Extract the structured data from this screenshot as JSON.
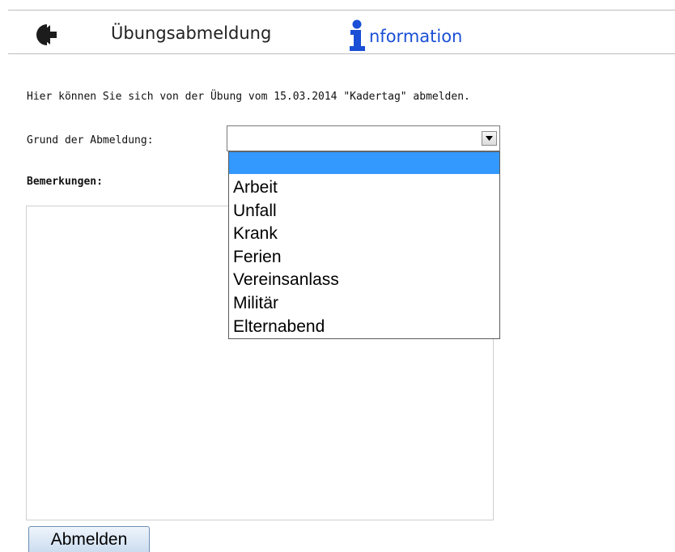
{
  "header": {
    "back_icon": "back-arrow-icon",
    "title": "Übungsabmeldung",
    "info_icon": "info-i-icon",
    "info_link": "nformation",
    "accent_color": "#1a4fd6"
  },
  "form": {
    "intro": "Hier können Sie sich von der Übung vom 15.03.2014 \"Kadertag\" abmelden.",
    "reason_label": "Grund der Abmeldung:",
    "reason_selected": "",
    "reason_options": [
      "",
      "Arbeit",
      "Unfall",
      "Krank",
      "Ferien",
      "Vereinsanlass",
      "Militär",
      "Elternabend"
    ],
    "remarks_label": "Bemerkungen:",
    "remarks_value": "",
    "submit_label": "Abmelden",
    "highlight_color": "#3399ff"
  }
}
